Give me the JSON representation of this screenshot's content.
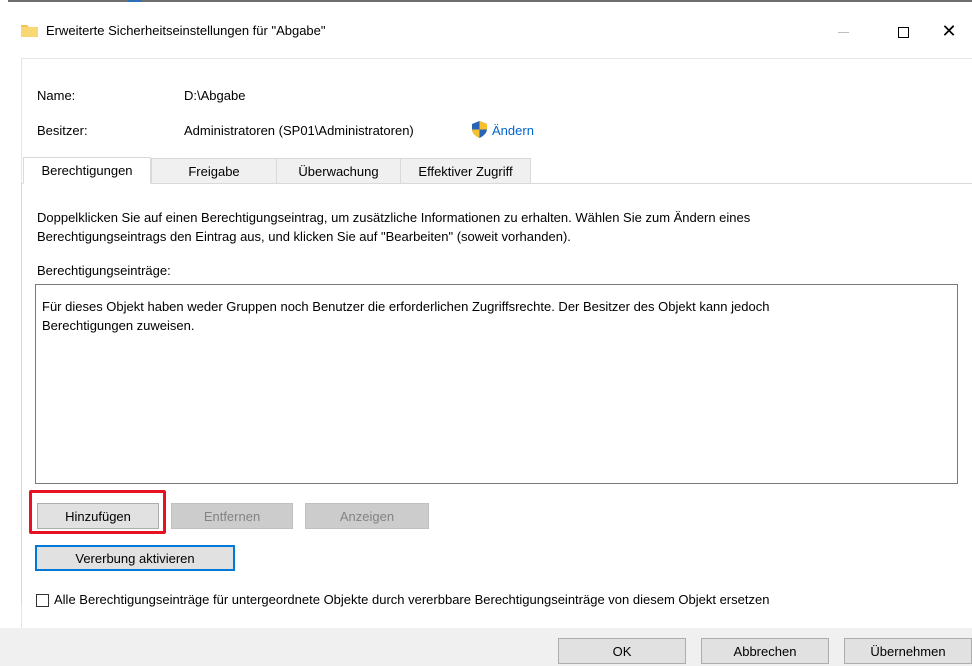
{
  "window": {
    "title": "Erweiterte Sicherheitseinstellungen für \"Abgabe\"",
    "controls": {
      "minimize": "—",
      "maximize": "☐",
      "close": "✕"
    }
  },
  "info": {
    "name_label": "Name:",
    "name_value": "D:\\Abgabe",
    "owner_label": "Besitzer:",
    "owner_value": "Administratoren (SP01\\Administratoren)",
    "change_link": "Ändern"
  },
  "tabs": [
    {
      "label": "Berechtigungen",
      "active": true
    },
    {
      "label": "Freigabe",
      "active": false
    },
    {
      "label": "Überwachung",
      "active": false
    },
    {
      "label": "Effektiver Zugriff",
      "active": false
    }
  ],
  "permissions": {
    "description_line1": "Doppelklicken Sie auf einen Berechtigungseintrag, um zusätzliche Informationen zu erhalten. Wählen Sie zum Ändern eines",
    "description_line2": "Berechtigungseintrags den Eintrag aus, und klicken Sie auf \"Bearbeiten\" (soweit vorhanden).",
    "entries_label": "Berechtigungseinträge:",
    "empty_message_line1": "Für dieses Objekt haben weder Gruppen noch Benutzer die erforderlichen Zugriffsrechte. Der Besitzer des Objekt kann jedoch",
    "empty_message_line2": "Berechtigungen zuweisen.",
    "add_button": "Hinzufügen",
    "remove_button": "Entfernen",
    "view_button": "Anzeigen",
    "inheritance_button": "Vererbung aktivieren",
    "replace_checkbox_label": "Alle Berechtigungseinträge für untergeordnete Objekte durch vererbbare Berechtigungseinträge von diesem Objekt ersetzen",
    "replace_checkbox_checked": false
  },
  "footer": {
    "ok_button": "OK",
    "cancel_button": "Abbrechen",
    "apply_button": "Übernehmen"
  },
  "colors": {
    "accent": "#0078d7",
    "link": "#0066cc",
    "highlight": "#e81123",
    "folder": "#f5c34b"
  }
}
